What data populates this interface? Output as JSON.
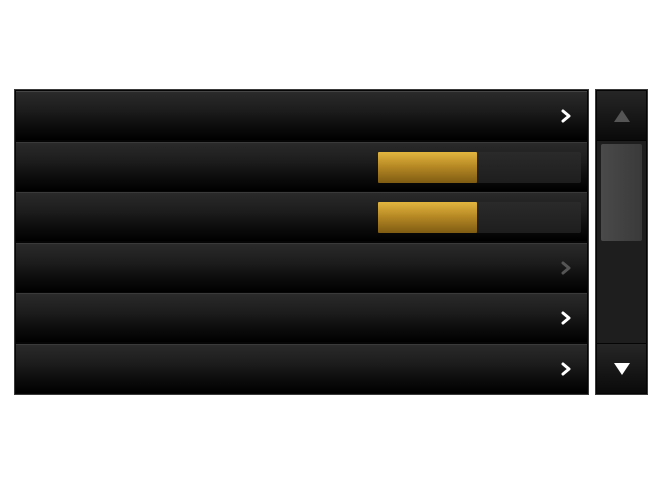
{
  "menu": {
    "rows": [
      {
        "kind": "nav",
        "enabled": true
      },
      {
        "kind": "slider",
        "value_fraction": 0.49
      },
      {
        "kind": "slider",
        "value_fraction": 0.49
      },
      {
        "kind": "nav",
        "enabled": false
      },
      {
        "kind": "nav",
        "enabled": true
      },
      {
        "kind": "nav",
        "enabled": true
      }
    ]
  },
  "scrollbar": {
    "up_icon": "triangle-up-icon",
    "down_icon": "triangle-down-icon",
    "up_enabled": false,
    "down_enabled": true,
    "thumb_start_fraction": 0.0,
    "thumb_size_fraction": 0.5
  },
  "colors": {
    "accent": "#c9982d",
    "background": "#050505",
    "chevron_enabled": "#ffffff",
    "chevron_disabled": "#555555",
    "scroll_up_disabled": "#555555"
  }
}
